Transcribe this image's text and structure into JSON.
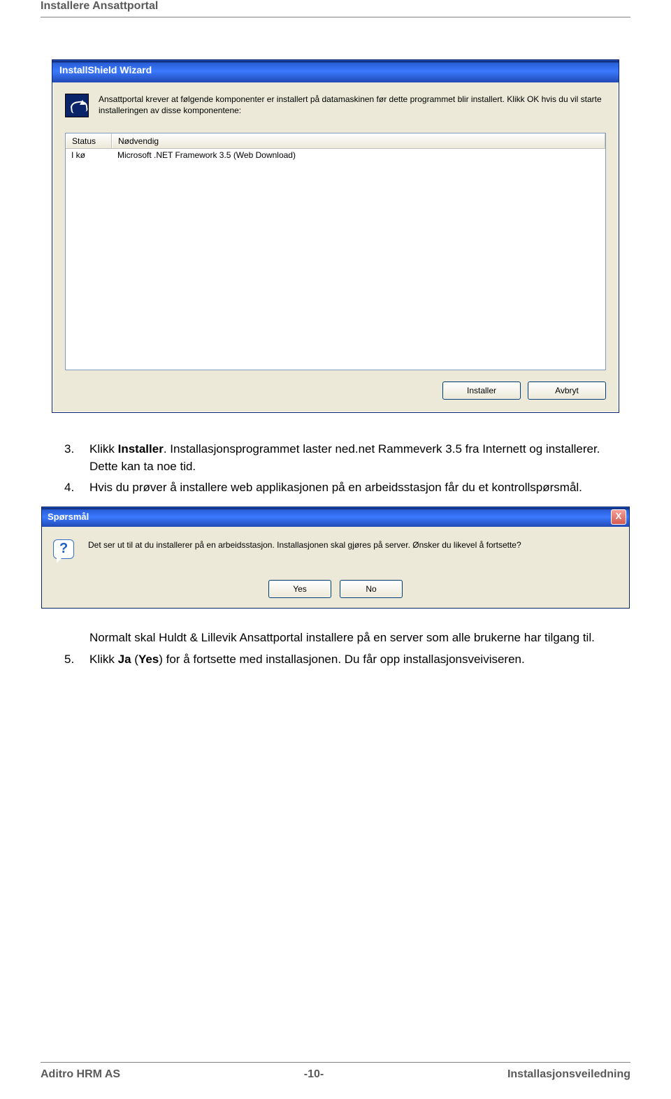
{
  "header": {
    "section": "Installere Ansattportal"
  },
  "wizard": {
    "title": "InstallShield Wizard",
    "intro": "Ansattportal krever at følgende komponenter er installert på datamaskinen før dette programmet blir installert. Klikk OK hvis du vil starte installeringen av disse komponentene:",
    "columns": {
      "status": "Status",
      "required": "Nødvendig"
    },
    "rows": [
      {
        "status": "I kø",
        "required": "Microsoft .NET Framework 3.5 (Web Download)"
      }
    ],
    "buttons": {
      "install": "Installer",
      "cancel": "Avbryt"
    }
  },
  "steps": {
    "s3": {
      "num": "3.",
      "pre": "Klikk ",
      "bold": "Installer",
      "post": ". Installasjonsprogrammet laster ned.net Rammeverk 3.5 fra Internett og installerer. Dette kan ta noe tid."
    },
    "s4": {
      "num": "4.",
      "text": "Hvis du prøver å installere web applikasjonen på en arbeidsstasjon får du et kontrollspørsmål."
    },
    "post4": "Normalt skal Huldt & Lillevik Ansattportal installere på en server som alle brukerne har tilgang til.",
    "s5": {
      "num": "5.",
      "pre": "Klikk ",
      "bold1": "Ja",
      "mid1": " (",
      "bold2": "Yes",
      "mid2": ") for å fortsette med installasjonen. Du får opp installasjonsveiviseren."
    }
  },
  "dialog": {
    "title": "Spørsmål",
    "close": "X",
    "message": "Det ser ut til at du installerer på en arbeidsstasjon. Installasjonen skal gjøres på server. Ønsker du likevel å fortsette?",
    "yes": "Yes",
    "no": "No"
  },
  "footer": {
    "left": "Aditro HRM AS",
    "center": "-10-",
    "right": "Installasjonsveiledning"
  }
}
